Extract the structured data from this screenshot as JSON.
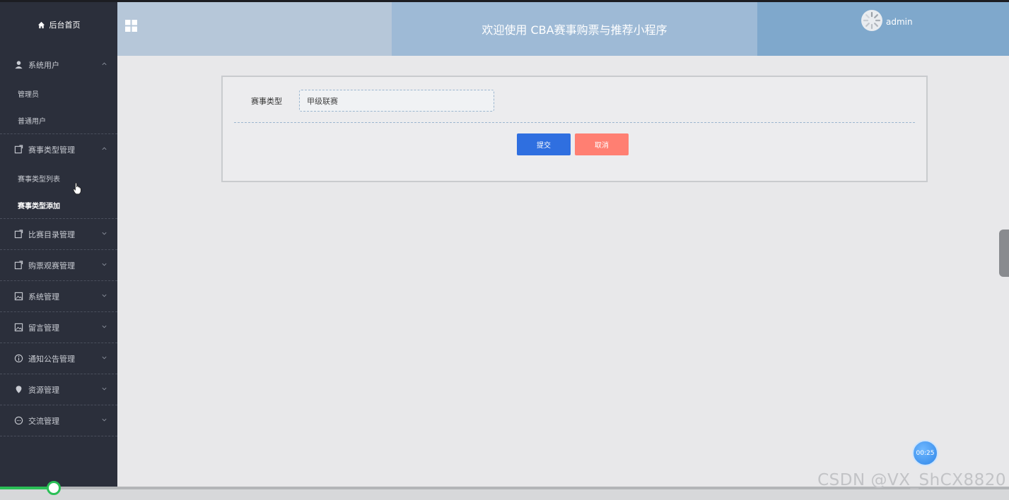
{
  "sidebar": {
    "home": "后台首页",
    "groups": [
      {
        "label": "系统用户",
        "icon": "user-icon",
        "expanded": true,
        "items": [
          "管理员",
          "普通用户"
        ]
      },
      {
        "label": "赛事类型管理",
        "icon": "edit-icon",
        "expanded": true,
        "items": [
          "赛事类型列表",
          "赛事类型添加"
        ]
      },
      {
        "label": "比赛目录管理",
        "icon": "edit-icon",
        "expanded": false
      },
      {
        "label": "购票观赛管理",
        "icon": "edit-icon",
        "expanded": false
      },
      {
        "label": "系统管理",
        "icon": "image-icon",
        "expanded": false
      },
      {
        "label": "留言管理",
        "icon": "image-icon",
        "expanded": false
      },
      {
        "label": "通知公告管理",
        "icon": "info-icon",
        "expanded": false
      },
      {
        "label": "资源管理",
        "icon": "location-icon",
        "expanded": false
      },
      {
        "label": "交流管理",
        "icon": "chat-icon",
        "expanded": false
      }
    ]
  },
  "header": {
    "title": "欢迎使用 CBA赛事购票与推荐小程序",
    "username": "admin"
  },
  "form": {
    "label": "赛事类型",
    "value": "甲级联赛",
    "submit": "提交",
    "cancel": "取消"
  },
  "timer": "00:25",
  "watermark": "CSDN @VX_ShCX8820",
  "video_progress_percent": 5.3,
  "colors": {
    "sidebar": "#2b2f3b",
    "submit": "#2f6fe0",
    "cancel": "#ff7f72",
    "progress": "#2bbf57"
  }
}
